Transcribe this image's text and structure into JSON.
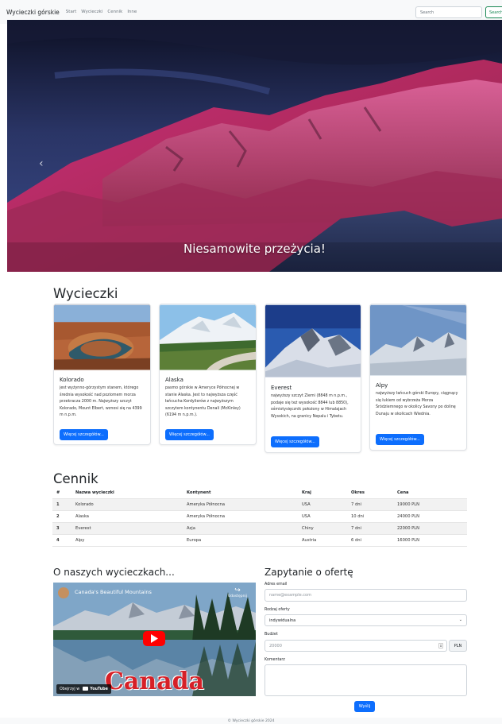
{
  "navbar": {
    "brand": "Wycieczki górskie",
    "links": [
      "Start",
      "Wycieczki",
      "Cennik",
      "Inne"
    ],
    "search_placeholder": "Search",
    "search_button": "Search"
  },
  "hero": {
    "caption": "Niesamowite przeżycia!",
    "prev_icon": "chevron-left-icon"
  },
  "tours": {
    "heading": "Wycieczki",
    "cards": [
      {
        "title": "Kolorado",
        "text": "jest wyżynno-górzystym stanem, którego średnia wysokość nad poziomem morza przekracza 2000 m. Najwyższy szczyt Kolorado, Mount Elbert, wznosi się na 4399 m n.p.m.",
        "button": "Więcej szczegółów..."
      },
      {
        "title": "Alaska",
        "text": "pasmo górskie w Ameryce Północnej w stanie Alaska. Jest to najwyższa część łańcucha Kordylierów z najwyższym szczytem kontynentu Denali (McKinley) (6194 m n.p.m.).",
        "button": "Więcej szczegółów..."
      },
      {
        "title": "Everest",
        "text": "najwyższy szczyt Ziemi (8848 m n.p.m., podaje się też wysokość 8844 lub 8850), ośmiotysięcznik położony w Himalajach Wysokich, na granicy Nepalu i Tybetu.",
        "button": "Więcej szczegółów..."
      },
      {
        "title": "Alpy",
        "text": "najwyższy łańcuch górski Europy, ciągnący się łukiem od wybrzeża Morza Śródziemnego w okolicy Savony po dolinę Dunaju w okolicach Wiednia.",
        "button": "Więcej szczegółów..."
      }
    ]
  },
  "pricing": {
    "heading": "Cennik",
    "columns": [
      "#",
      "Nazwa wycieczki",
      "Kontynent",
      "Kraj",
      "Okres",
      "Cena"
    ],
    "rows": [
      [
        "1",
        "Kolorado",
        "Ameryka Północna",
        "USA",
        "7 dni",
        "19000 PLN"
      ],
      [
        "2",
        "Alaska",
        "Ameryka Północna",
        "USA",
        "10 dni",
        "24000 PLN"
      ],
      [
        "3",
        "Everest",
        "Azja",
        "Chiny",
        "7 dni",
        "22000 PLN"
      ],
      [
        "4",
        "Alpy",
        "Europa",
        "Austria",
        "6 dni",
        "16000 PLN"
      ]
    ]
  },
  "about": {
    "heading": "O naszych wycieczkach...",
    "video": {
      "title": "Canada's Beautiful Mountains",
      "share": "Udostępnij",
      "overlay_text": "Canada",
      "watch_on": "Obejrzyj w",
      "youtube": "YouTube"
    }
  },
  "form": {
    "heading": "Zapytanie o ofertę",
    "email_label": "Adres email",
    "email_placeholder": "name@example.com",
    "type_label": "Rodzaj oferty",
    "type_value": "indywidualna",
    "budget_label": "Budżet",
    "budget_placeholder": "20000",
    "budget_unit": "PLN",
    "comment_label": "Komentarz",
    "submit": "Wyślij"
  },
  "footer": {
    "text": "© Wycieczki górskie 2024"
  },
  "colors": {
    "primary": "#0d6efd",
    "success": "#198754",
    "navbar_bg": "#f8f9fa"
  }
}
